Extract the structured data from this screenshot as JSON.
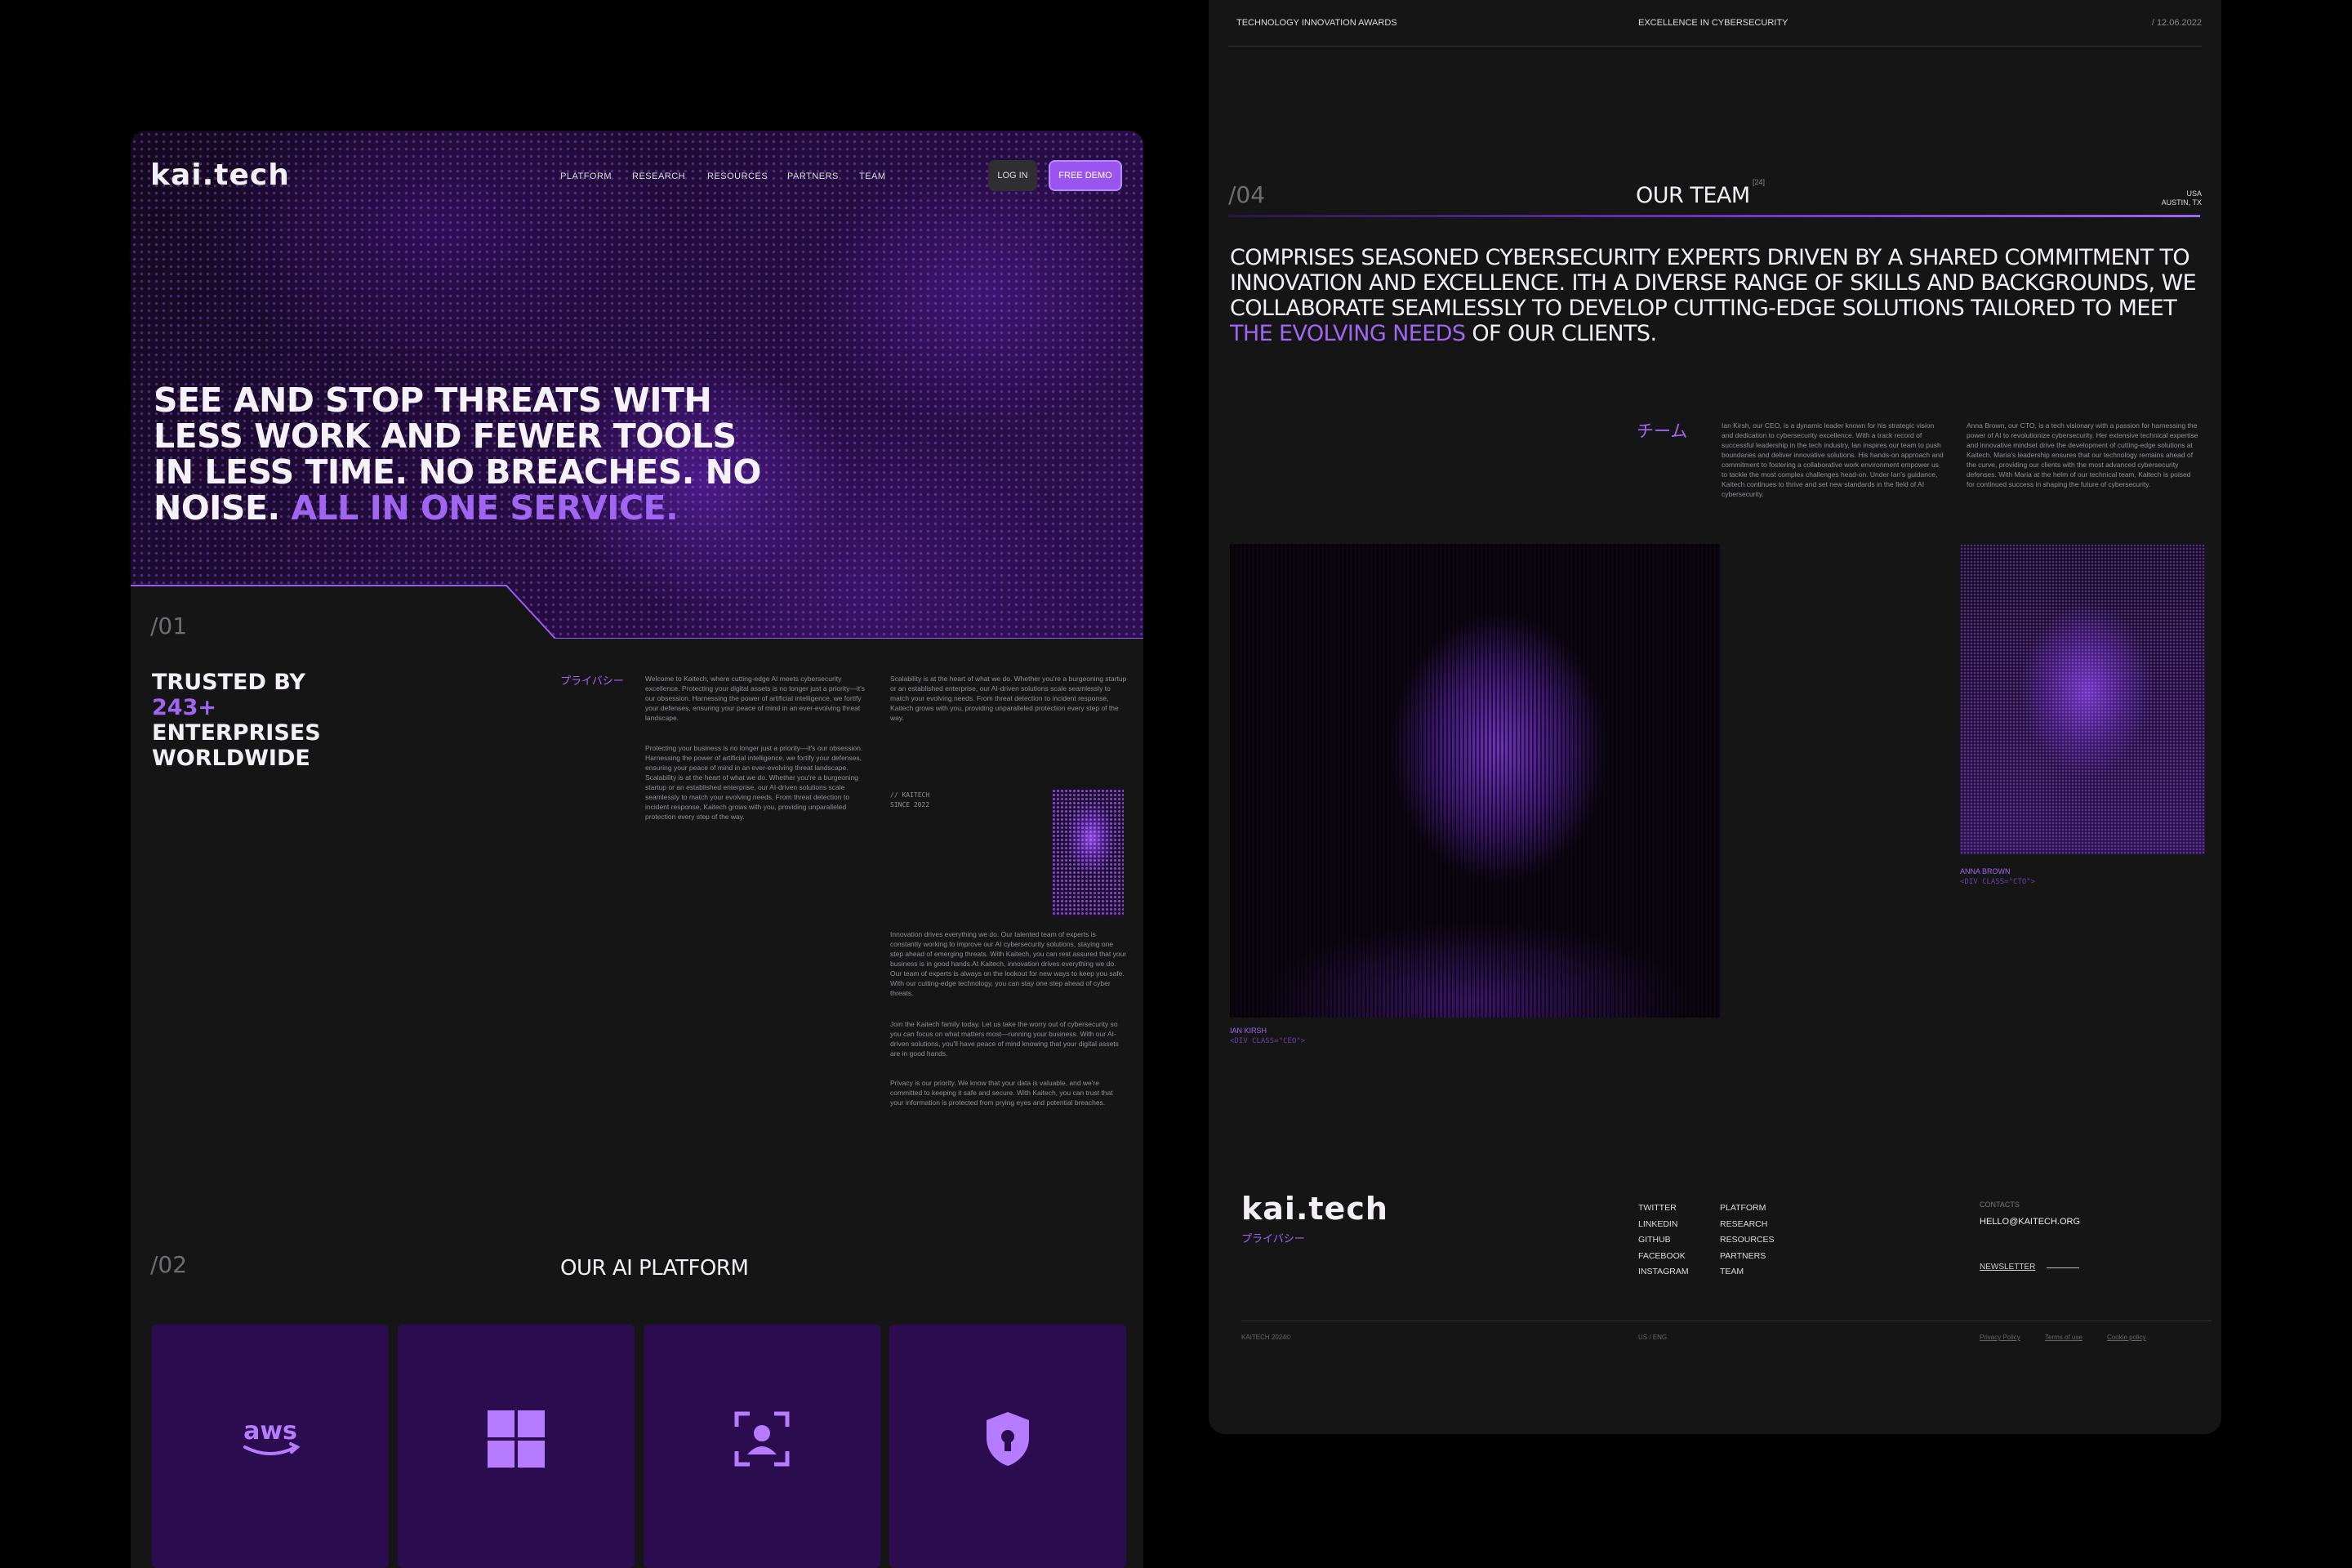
{
  "left": {
    "logo": "kai.tech",
    "nav": [
      "PLATFORM",
      "RESEARCH",
      "RESOURCES",
      "PARTNERS",
      "TEAM"
    ],
    "login_label": "LOG IN",
    "demo_label": "FREE DEMO",
    "headline_main": "SEE AND STOP THREATS WITH LESS WORK AND FEWER TOOLS IN LESS TIME. NO BREACHES. NO NOISE.",
    "headline_accent": "ALL IN ONE SERVICE.",
    "section1_num": "/01",
    "trusted_prefix": "TRUSTED BY",
    "trusted_count": "243+",
    "trusted_suffix": "ENTERPRISES WORLDWIDE",
    "privacy_jp": "プライバシー",
    "para1": "Welcome to Kaitech, where cutting-edge AI meets cybersecurity excellence. Protecting your digital assets is no longer just a priority—it's our obsession. Harnessing the power of artificial intelligence, we fortify your defenses, ensuring your peace of mind in an ever-evolving threat landscape.",
    "para2": "Protecting your business is no longer just a priority—it's our obsession. Harnessing the power of artificial intelligence, we fortify your defenses, ensuring your peace of mind in an ever-evolving threat landscape. Scalability is at the heart of what we do. Whether you're a burgeoning startup or an established enterprise, our AI-driven solutions scale seamlessly to match your evolving needs. From threat detection to incident response, Kaitech grows with you, providing unparalleled protection every step of the way.",
    "para3": "Scalability is at the heart of what we do. Whether you're a burgeoning startup or an established enterprise, our AI-driven solutions scale seamlessly to match your evolving needs. From threat detection to incident response, Kaitech grows with you, providing unparalleled protection every step of the way.",
    "since_line1": "// KAITECH",
    "since_line2": "SINCE 2022",
    "para4": "Innovation drives everything we do. Our talented team of experts is constantly working to improve our AI cybersecurity solutions, staying one step ahead of emerging threats. With Kaitech, you can rest assured that your business is in good hands.At Kaitech, innovation drives everything we do. Our team of experts is always on the lookout for new ways to keep you safe. With our cutting-edge technology, you can stay one step ahead of cyber threats.",
    "para5": "Join the Kaitech family today. Let us take the worry out of cybersecurity so you can focus on what matters most—running your business. With our AI-driven solutions, you'll have peace of mind knowing that your digital assets are in good hands.",
    "para6": "Privacy is our priority. We know that your data is valuable, and we're committed to keeping it safe and secure. With Kaitech, you can trust that your information is protected from prying eyes and potential breaches.",
    "section2_num": "/02",
    "section2_title": "OUR AI PLATFORM",
    "platform_cards": [
      {
        "icon": "aws-logo-icon",
        "text": "aws"
      },
      {
        "icon": "windows-logo-icon"
      },
      {
        "icon": "face-scan-icon"
      },
      {
        "icon": "shield-lock-icon"
      }
    ],
    "accent_color": "#a066f2",
    "card_color": "#2b0d4f"
  },
  "right": {
    "awards_left": "TECHNOLOGY INNOVATION AWARDS",
    "awards_center": "EXCELLENCE IN CYBERSECURITY",
    "awards_date": "/ 12.06.2022",
    "section_num": "/04",
    "team_title": "OUR TEAM",
    "team_count": "[24]",
    "location_country": "USA",
    "location_city": "AUSTIN, TX",
    "team_statement_main": "COMPRISES SEASONED CYBERSECURITY EXPERTS DRIVEN BY A SHARED COMMITMENT TO INNOVATION AND EXCELLENCE. ITH A DIVERSE RANGE OF SKILLS AND BACKGROUNDS, WE COLLABORATE SEAMLESSLY TO DEVELOP CUTTING-EDGE SOLUTIONS TAILORED TO MEET",
    "team_statement_accent": "THE EVOLVING NEEDS",
    "team_statement_end": "OF OUR CLIENTS.",
    "team_jp": "チーム",
    "ceo_bio": "Ian Kirsh, our CEO, is a dynamic leader known for his strategic vision and dedication to cybersecurity excellence. With a track record of successful leadership in the tech industry, Ian inspires our team to push boundaries and deliver innovative solutions. His hands-on approach and commitment to fostering a collaborative work environment empower us to tackle the most complex challenges head-on. Under Ian's guidance, Kaitech continues to thrive and set new standards in the field of AI cybersecurity.",
    "cto_bio": "Anna Brown, our CTO, is a tech visionary with a passion for harnessing the power of AI to revolutionize cybersecurity. Her extensive technical expertise and innovative mindset drive the development of cutting-edge solutions at Kaitech. Maria's leadership ensures that our technology remains ahead of the curve, providing our clients with the most advanced cybersecurity defenses. With Maria at the helm of our technical team, Kaitech is poised for continued success in shaping the future of cybersecurity.",
    "ceo_name": "IAN KIRSH",
    "ceo_tag": "<DIV CLASS=\"CEO\">",
    "cto_name": "ANNA BROWN",
    "cto_tag": "<DIV CLASS=\"CTO\">",
    "footer_logo": "kai.tech",
    "footer_jp": "プライバシー",
    "social": [
      "TWITTER",
      "LINKEDIN",
      "GITHUB",
      "FACEBOOK",
      "INSTAGRAM"
    ],
    "footer_nav": [
      "PLATFORM",
      "RESEARCH",
      "RESOURCES",
      "PARTNERS",
      "TEAM"
    ],
    "contacts_label": "CONTACTS",
    "contact_email": "HELLO@KAITECH.ORG",
    "newsletter_label": "NEWSLETTER",
    "copyright": "KAITECH 2024©",
    "lang": "US / ENG",
    "legal": [
      "Privacy Policy",
      "Terms of use",
      "Cookie policy"
    ]
  }
}
